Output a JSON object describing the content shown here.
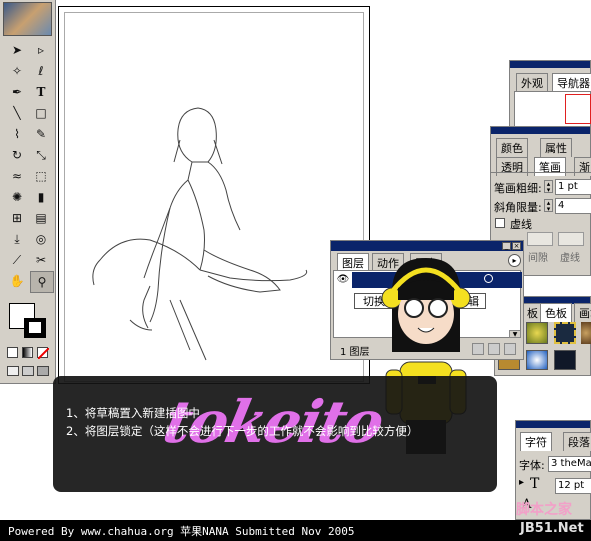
{
  "toolbox": {
    "tools": [
      "selection-tool",
      "direct-selection-tool",
      "magic-wand-tool",
      "lasso-tool",
      "pen-tool",
      "type-tool",
      "line-tool",
      "rectangle-tool",
      "paintbrush-tool",
      "pencil-tool",
      "rotate-tool",
      "scale-tool",
      "warp-tool",
      "free-transform-tool",
      "symbol-sprayer-tool",
      "column-graph-tool",
      "mesh-tool",
      "gradient-tool",
      "eyedropper-tool",
      "blend-tool",
      "slice-tool",
      "scissors-tool",
      "hand-tool",
      "zoom-tool"
    ],
    "type_glyph": "T"
  },
  "navigator_panel": {
    "tabs": [
      "外观",
      "导航器"
    ]
  },
  "stroke_panel": {
    "tabs_top": [
      "颜色",
      "属性"
    ],
    "tabs": [
      "透明",
      "笔画",
      "渐"
    ],
    "weight_label": "笔画粗细:",
    "weight_value": "1 pt",
    "miter_label": "斜角限量:",
    "miter_value": "4",
    "dashed_label": "虚线",
    "dash_labels": [
      "间隙",
      "虚线"
    ]
  },
  "layers_panel": {
    "tabs": [
      "图层",
      "动作",
      "历史"
    ],
    "layer_name": "",
    "button_a": "切换",
    "button_b": "编辑",
    "footer_text": "1 图层"
  },
  "swatches_panel": {
    "tabs": [
      "板",
      "色板",
      "画笔"
    ]
  },
  "character_panel": {
    "tabs": [
      "字符",
      "段落"
    ],
    "font_label": "字体:",
    "font_value": "3 theMa",
    "size_value": "12 pt",
    "mark_t": "T",
    "mark_a": "A"
  },
  "overlay": {
    "line1": "1、将草稿置入新建插图中",
    "line2": "2、将图层锁定（这样不会进行下一步的工作就不会影响到比较方便）",
    "signature": "tokeito"
  },
  "footer": {
    "text": "Powered By www.chahua.org 苹果NANA Submitted Nov 2005"
  },
  "watermark": {
    "top": "脚本之家",
    "bottom": "JB51.Net"
  }
}
